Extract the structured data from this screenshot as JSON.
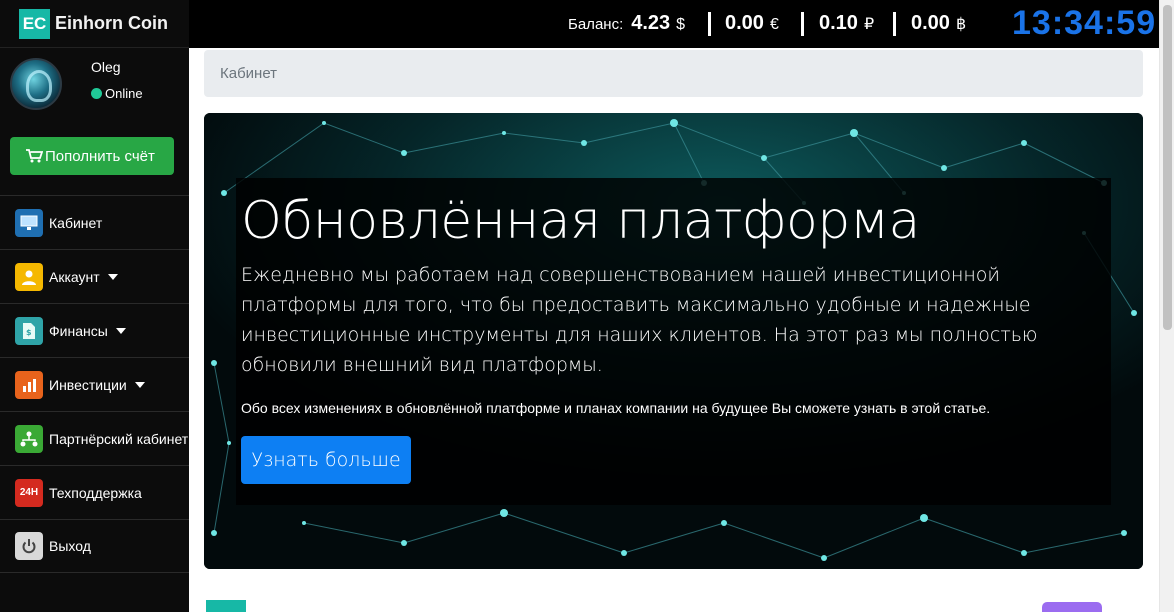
{
  "brand": {
    "logo": "EC",
    "name": "Einhorn Coin",
    "color": "#17b8a6"
  },
  "user": {
    "name": "Oleg",
    "status": "Online",
    "status_color": "#20c997"
  },
  "topup": {
    "label": "Пополнить счёт",
    "icon": "cart-icon",
    "color": "#28a745"
  },
  "nav": [
    {
      "label": "Кабинет",
      "icon": "monitor-icon",
      "color": "#1f6fb2",
      "dropdown": false
    },
    {
      "label": "Аккаунт",
      "icon": "user-icon",
      "color": "#f5b800",
      "dropdown": true
    },
    {
      "label": "Финансы",
      "icon": "document-icon",
      "color": "#2fa4a8",
      "dropdown": true
    },
    {
      "label": "Инвестиции",
      "icon": "chart-icon",
      "color": "#e8631c",
      "dropdown": true
    },
    {
      "label": "Партнёрский кабинет",
      "icon": "network-icon",
      "color": "#3aa935",
      "dropdown": false
    },
    {
      "label": "Техподдержка",
      "icon": "support-24h-icon",
      "icon_text": "24H",
      "color": "#d42a1f",
      "dropdown": false
    },
    {
      "label": "Выход",
      "icon": "power-icon",
      "color": "#d9d9d9",
      "dropdown": false
    }
  ],
  "header": {
    "balance_label": "Баланс:",
    "balances": [
      {
        "value": "4.23",
        "currency": "$"
      },
      {
        "value": "0.00",
        "currency": "€"
      },
      {
        "value": "0.10",
        "currency": "₽"
      },
      {
        "value": "0.00",
        "currency": "฿"
      }
    ],
    "clock": "13:34:59",
    "clock_color": "#1a73e8"
  },
  "breadcrumb": {
    "current": "Кабинет"
  },
  "banner": {
    "title": "Обновлённая платформа",
    "text": "Ежедневно мы работаем над совершенствованием нашей инвестиционной платформы для того, что бы предоставить максимально удобные и надежные инвестиционные инструменты для наших клиентов. На этот раз мы полностью обновили внешний вид платформы.",
    "note": "Обо всех изменениях в обновлённой платформе и планах компании на будущее Вы сможете узнать в этой статье.",
    "button": "Узнать больше",
    "button_color": "#0d7ff3"
  }
}
